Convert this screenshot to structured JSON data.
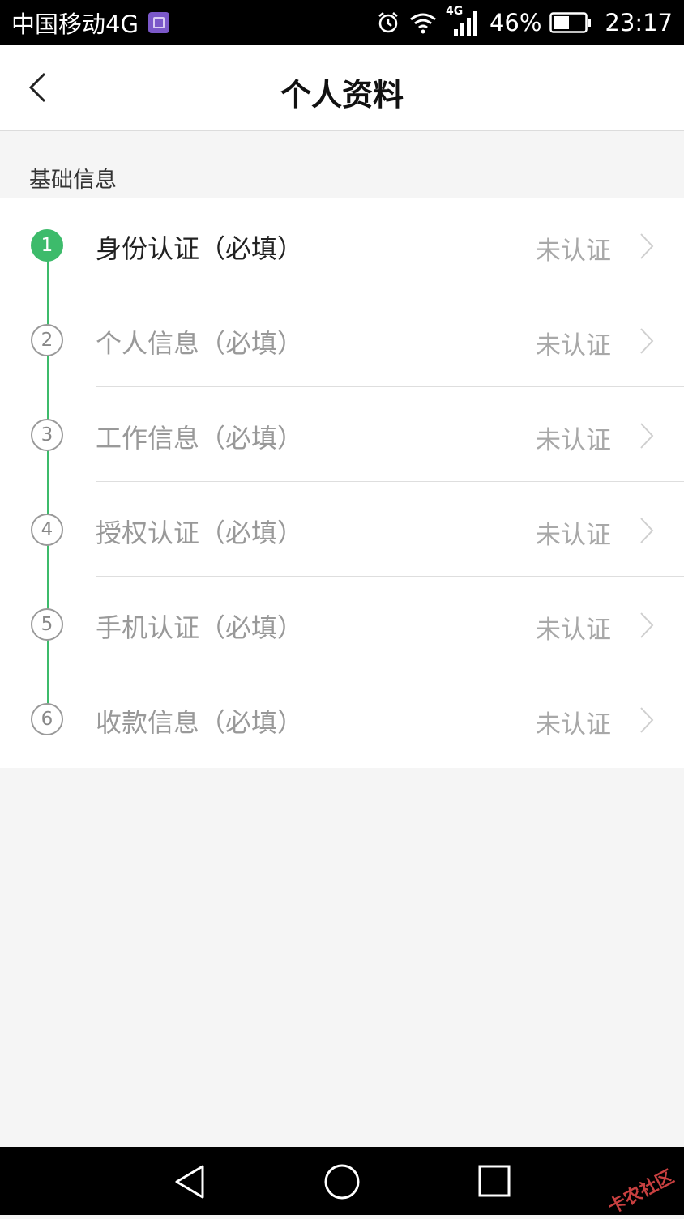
{
  "status_bar": {
    "carrier": "中国移动4G",
    "network": "4G",
    "battery_percent": "46%",
    "time": "23:17",
    "icons": [
      "gallery-icon",
      "alarm-icon",
      "wifi-icon",
      "signal-icon",
      "battery-icon"
    ]
  },
  "nav": {
    "title": "个人资料",
    "back_icon": "chevron-left-icon"
  },
  "section": {
    "title": "基础信息"
  },
  "steps": [
    {
      "number": "1",
      "label": "身份认证（必填）",
      "status": "未认证",
      "active": true
    },
    {
      "number": "2",
      "label": "个人信息（必填）",
      "status": "未认证",
      "active": false
    },
    {
      "number": "3",
      "label": "工作信息（必填）",
      "status": "未认证",
      "active": false
    },
    {
      "number": "4",
      "label": "授权认证（必填）",
      "status": "未认证",
      "active": false
    },
    {
      "number": "5",
      "label": "手机认证（必填）",
      "status": "未认证",
      "active": false
    },
    {
      "number": "6",
      "label": "收款信息（必填）",
      "status": "未认证",
      "active": false
    }
  ],
  "system_nav": {
    "icons": [
      "back-triangle-icon",
      "home-circle-icon",
      "recents-square-icon"
    ]
  },
  "watermark": "卡农社区",
  "colors": {
    "accent_green": "#3dbb6b",
    "status_bar_bg": "#000000",
    "page_bg": "#f5f5f5"
  }
}
